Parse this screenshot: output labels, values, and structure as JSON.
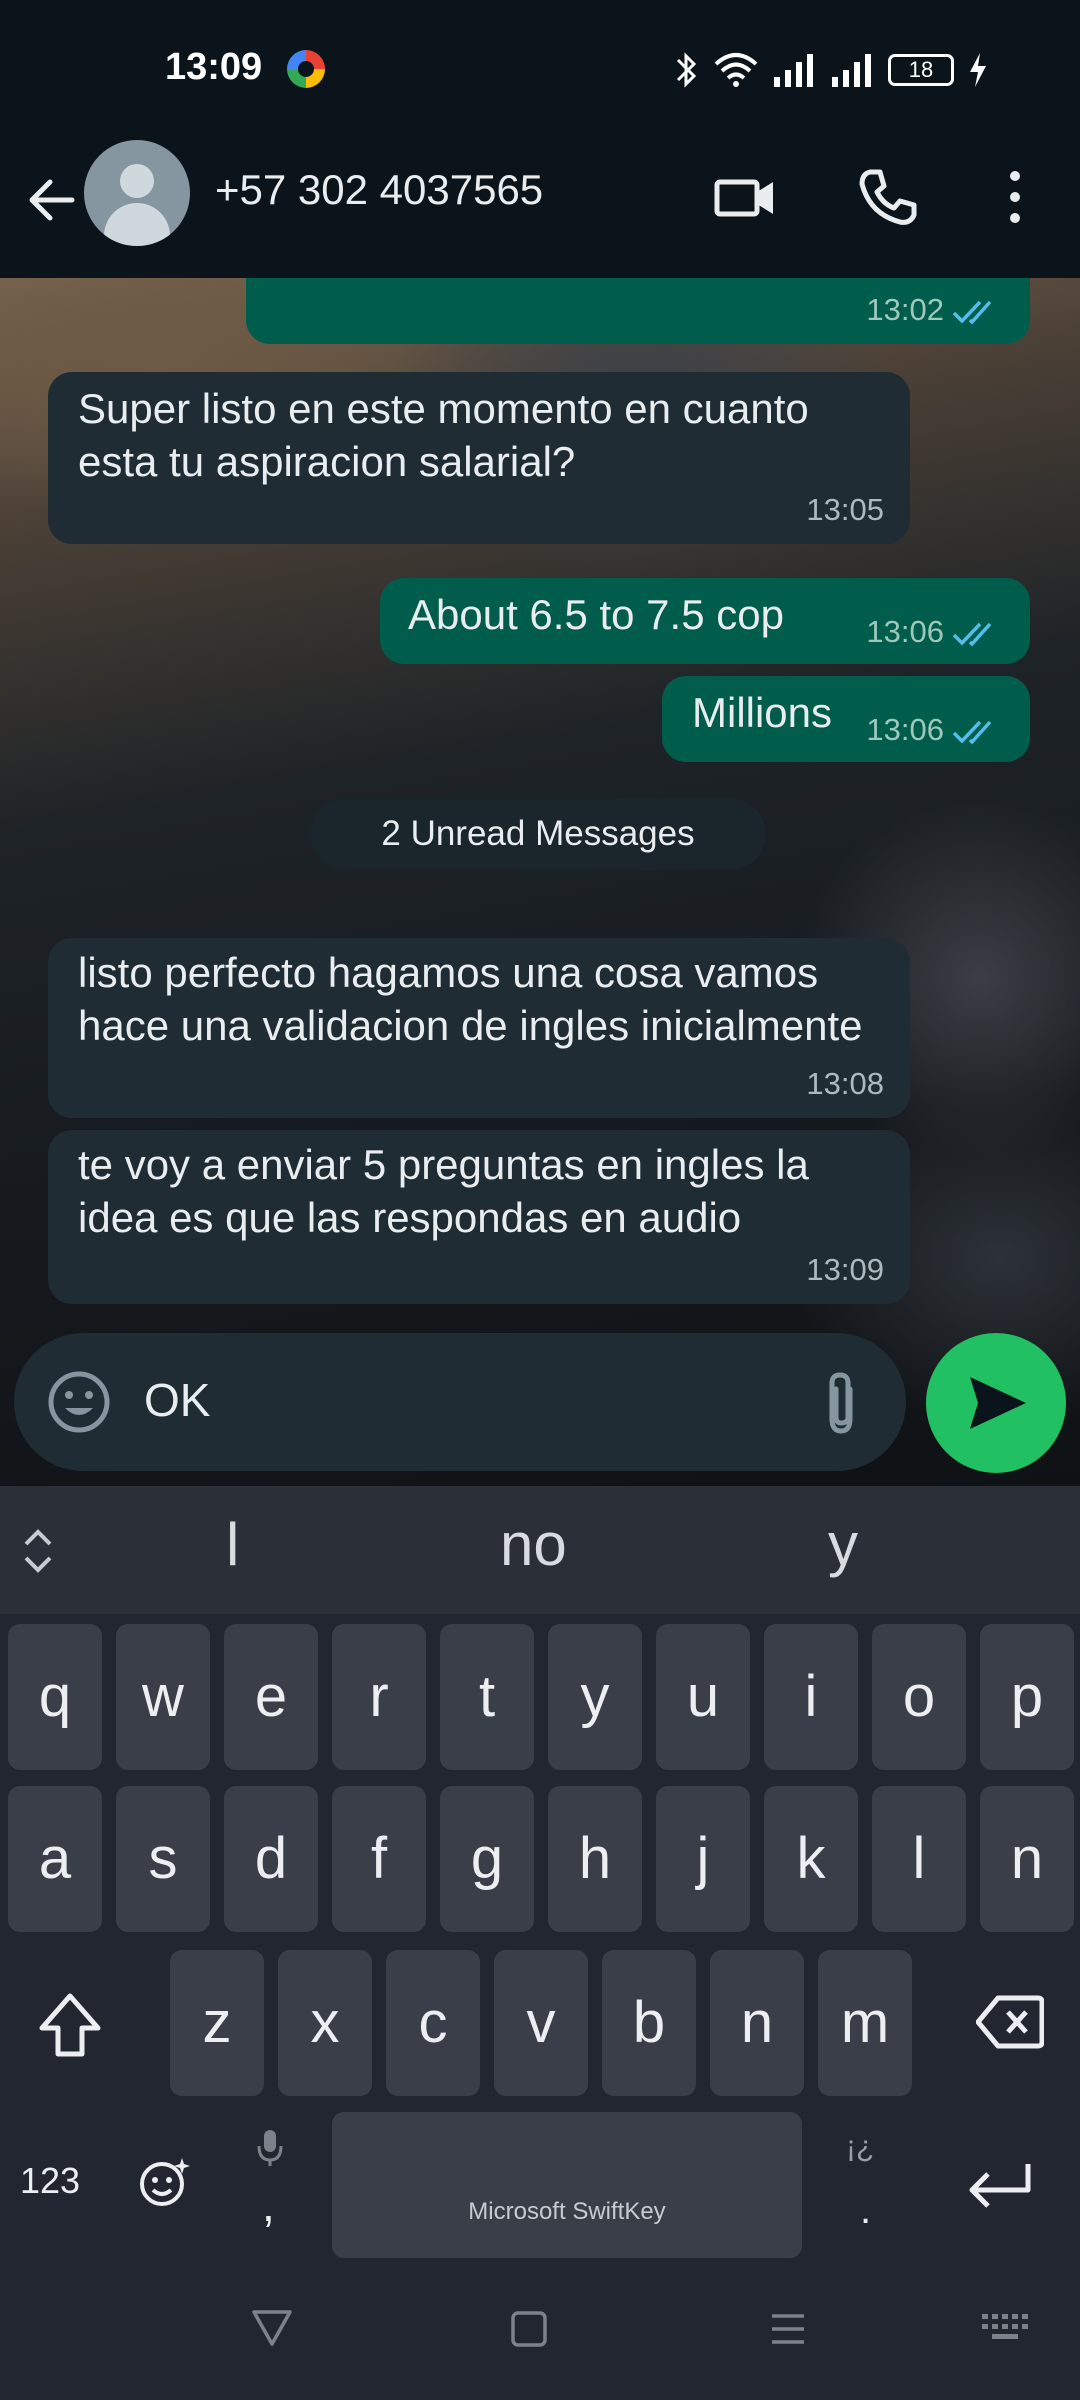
{
  "status_bar": {
    "time": "13:09",
    "battery": "18"
  },
  "header": {
    "contact": "+57 302 4037565"
  },
  "messages": [
    {
      "dir": "out",
      "text": "",
      "time": "13:02"
    },
    {
      "dir": "in",
      "text": "Super listo en este momento en cuanto esta tu aspiracion salarial?",
      "time": "13:05"
    },
    {
      "dir": "out",
      "text": "About 6.5 to 7.5 cop",
      "time": "13:06"
    },
    {
      "dir": "out",
      "text": "Millions",
      "time": "13:06"
    },
    {
      "dir": "in",
      "text": "listo perfecto hagamos una cosa vamos hace una validacion de ingles inicialmente",
      "time": "13:08"
    },
    {
      "dir": "in",
      "text": "te voy a enviar 5 preguntas en ingles la idea es que las respondas en audio",
      "time": "13:09"
    }
  ],
  "unread_label": "2 Unread Messages",
  "composer": {
    "text": "OK"
  },
  "keyboard": {
    "suggestions": [
      "l",
      "no",
      "y"
    ],
    "row1": [
      "q",
      "w",
      "e",
      "r",
      "t",
      "y",
      "u",
      "i",
      "o",
      "p"
    ],
    "row2": [
      "a",
      "s",
      "d",
      "f",
      "g",
      "h",
      "j",
      "k",
      "l",
      "n"
    ],
    "row3": [
      "z",
      "x",
      "c",
      "v",
      "b",
      "n",
      "m"
    ],
    "num_label": "123",
    "comma": ",",
    "period": ".",
    "punct_hint": "¡¿",
    "space_label": "Microsoft SwiftKey"
  },
  "colors": {
    "outgoing": "#005c4b",
    "incoming": "#1f2c34",
    "send": "#21c063",
    "read_ticks": "#53bdeb"
  }
}
